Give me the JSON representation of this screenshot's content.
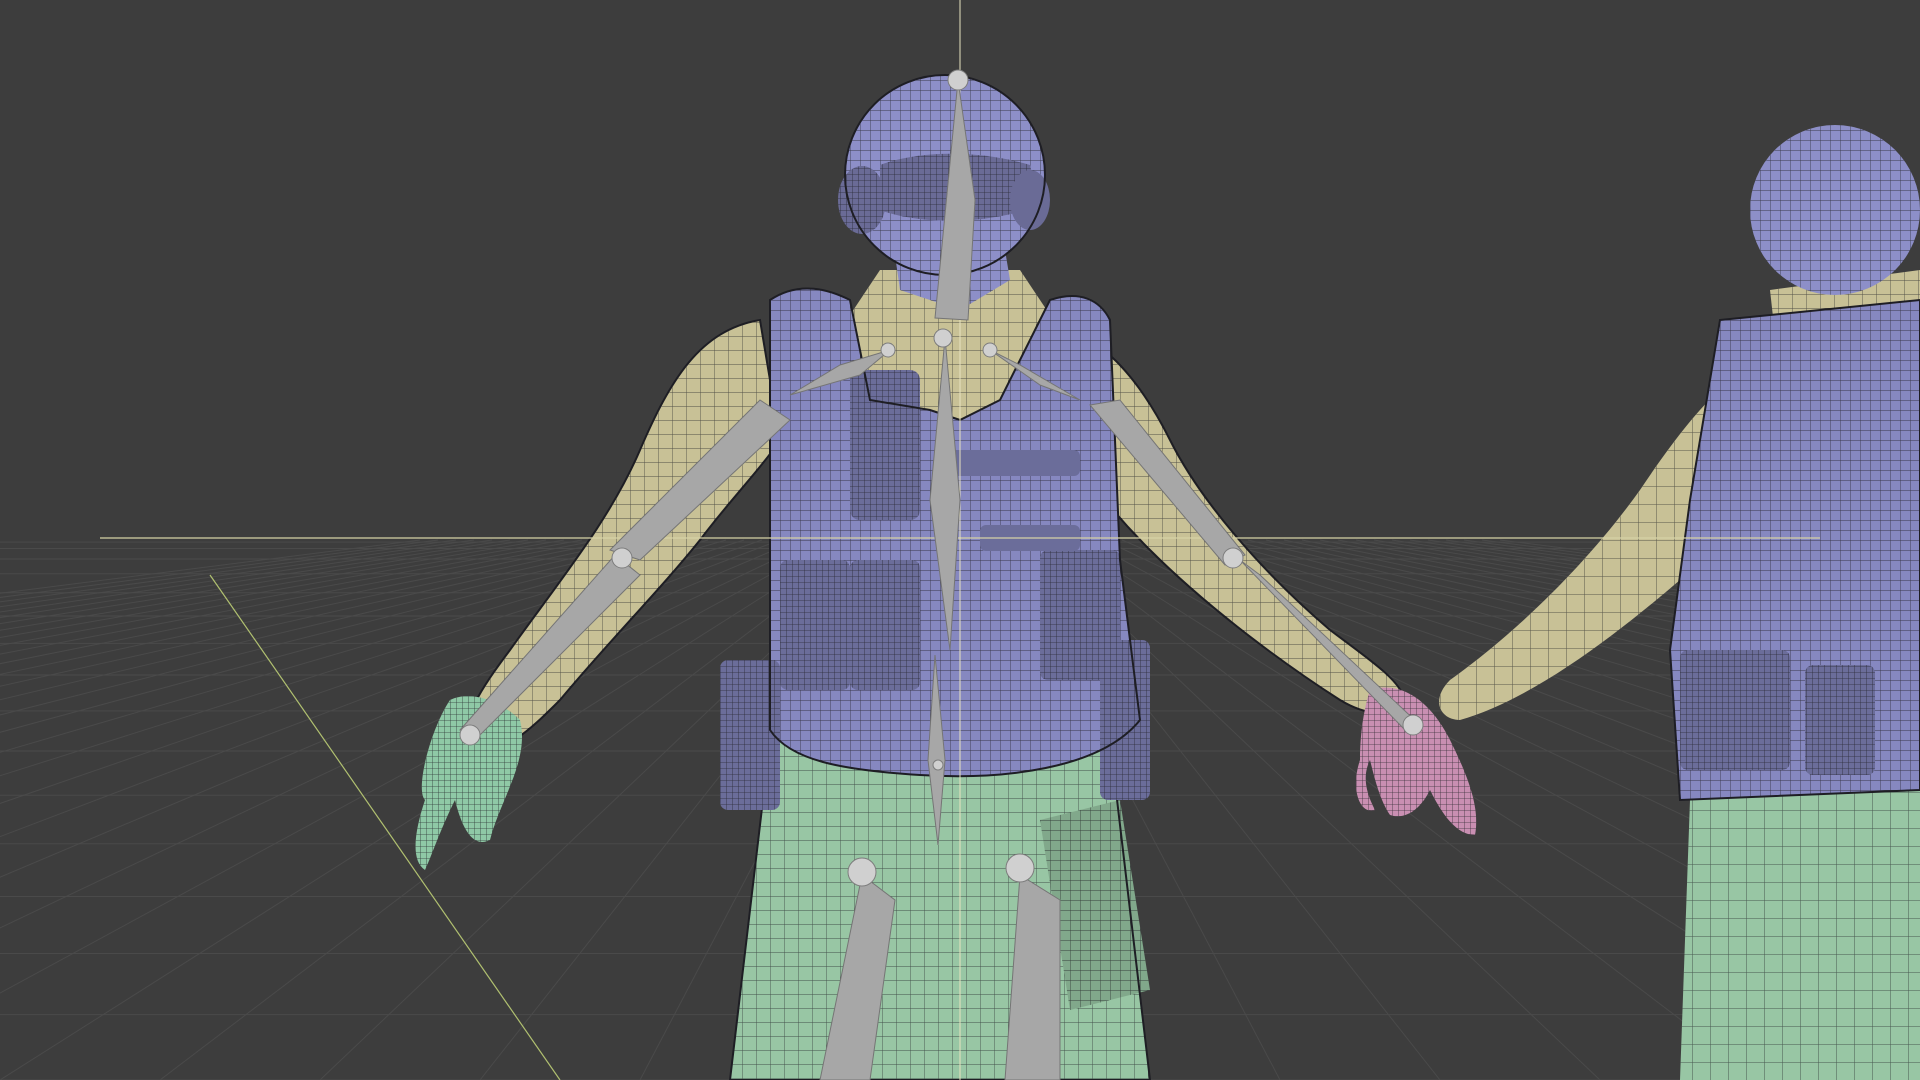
{
  "viewport": {
    "mode": "3d-viewport",
    "background_color": "#3d3d3d",
    "grid_color": "#4a4a4a",
    "axis_x_color": "#d6d2a6",
    "axis_y_color": "#b0c070",
    "cursor_color": "#e8e4c0"
  },
  "scene": {
    "object": "armature-character",
    "material_colors": {
      "helmet": "#8d8fc8",
      "shirt": "#c8c196",
      "vest": "#8688c0",
      "pants": "#98c6a4",
      "left_glove": "#8fc9a6",
      "right_glove": "#c98fb2",
      "bones": "#a7a7a7",
      "joint": "#d0d0d0",
      "wire": "#1e1e24"
    }
  }
}
